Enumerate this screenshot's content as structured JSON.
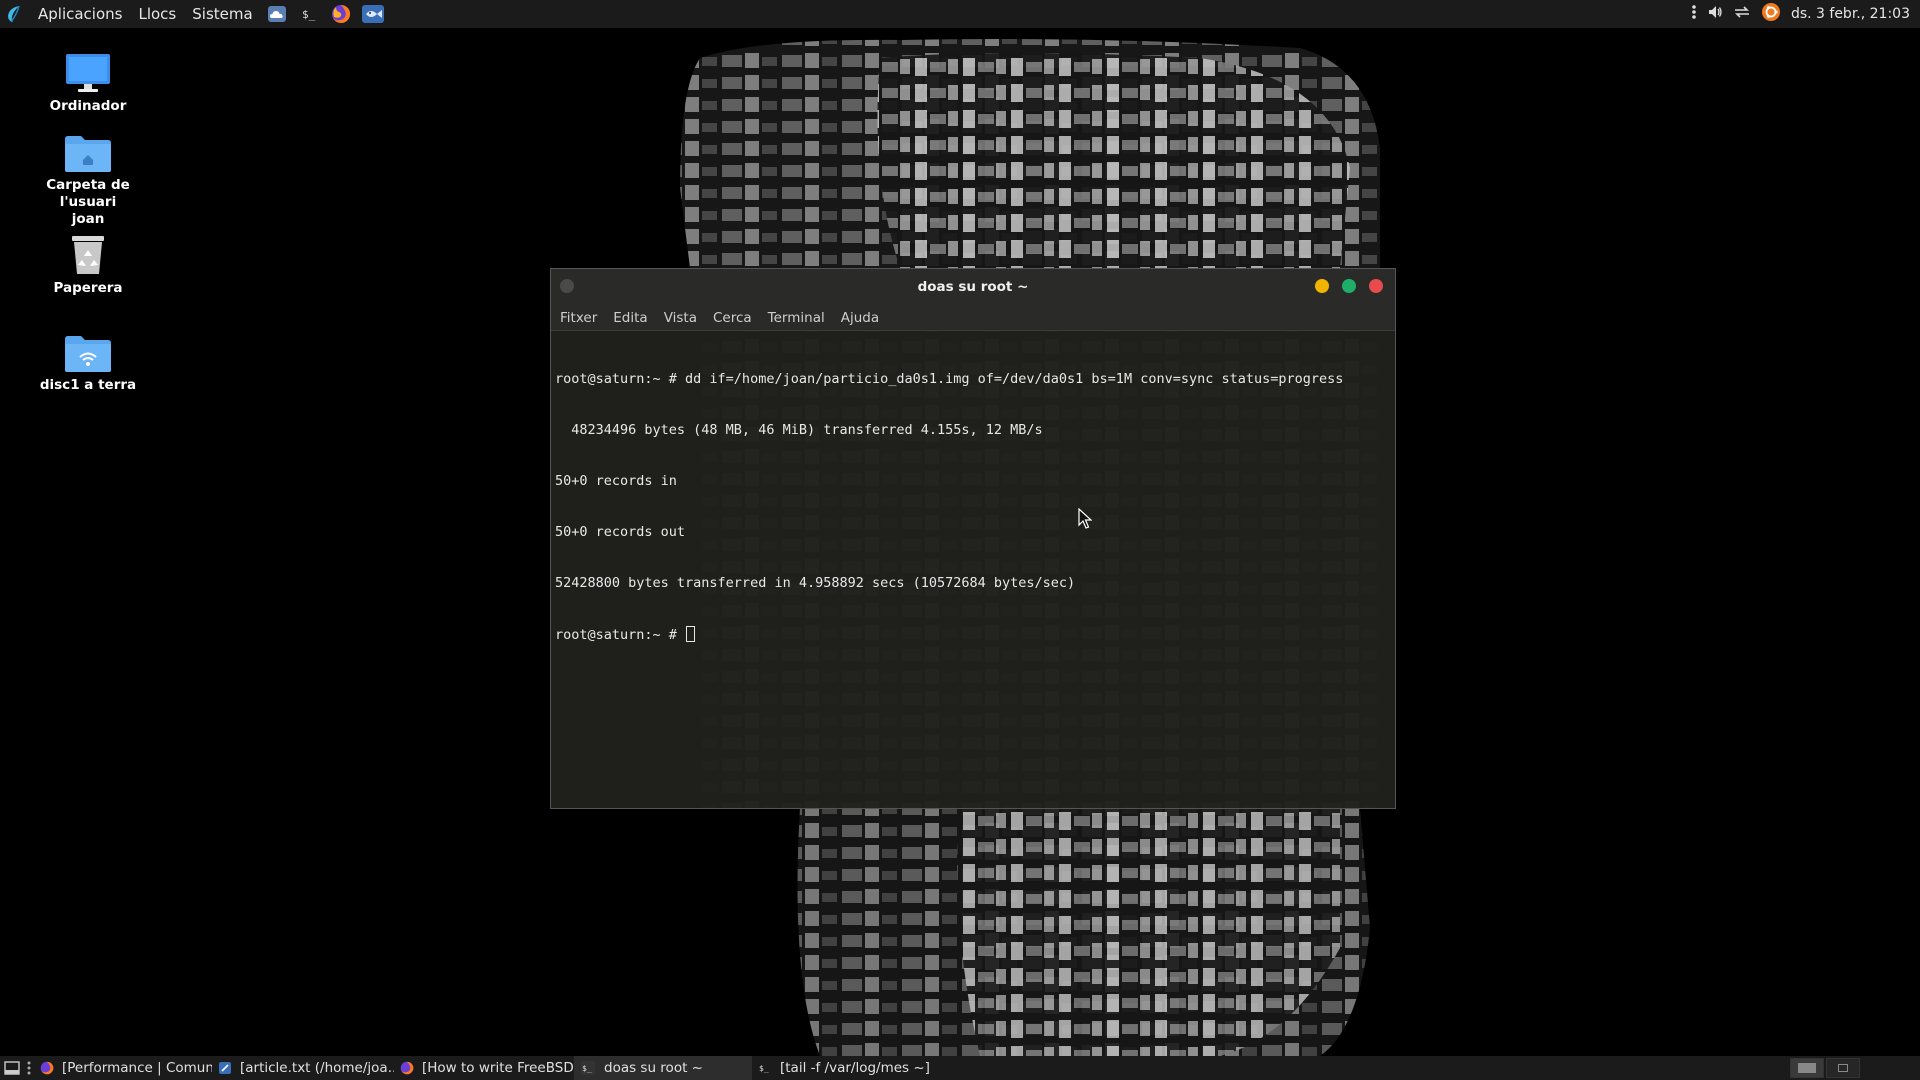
{
  "top_panel": {
    "menus": [
      "Aplicacions",
      "Llocs",
      "Sistema"
    ],
    "launchers": [
      "cloud-icon",
      "terminal-icon",
      "firefox-icon",
      "fish-icon"
    ],
    "tray_icons": [
      "menu-dots-icon",
      "volume-icon",
      "network-icon",
      "ubuntu-icon"
    ],
    "clock": "ds. 3 febr., 21:03"
  },
  "desktop_icons": [
    {
      "label": "Ordinador",
      "icon": "computer-icon"
    },
    {
      "label": "Carpeta de l'usuari\njoan",
      "icon": "home-folder-icon"
    },
    {
      "label": "Paperera",
      "icon": "trash-icon"
    },
    {
      "label": "disc1 a terra",
      "icon": "network-folder-icon"
    }
  ],
  "terminal": {
    "title": "doas su root ~",
    "menu": [
      "Fitxer",
      "Edita",
      "Vista",
      "Cerca",
      "Terminal",
      "Ajuda"
    ],
    "lines": [
      "root@saturn:~ # dd if=/home/joan/particio_da0s1.img of=/dev/da0s1 bs=1M conv=sync status=progress",
      "  48234496 bytes (48 MB, 46 MiB) transferred 4.155s, 12 MB/s",
      "50+0 records in",
      "50+0 records out",
      "52428800 bytes transferred in 4.958892 secs (10572684 bytes/sec)"
    ],
    "prompt": "root@saturn:~ # ",
    "colors": {
      "minimize": "#f0b400",
      "maximize": "#1fae6a",
      "close": "#e74c4c"
    }
  },
  "taskbar": {
    "tasks": [
      {
        "label": "[Performance | Comun...",
        "icon": "firefox-icon"
      },
      {
        "label": "[article.txt (/home/joa...",
        "icon": "editor-icon"
      },
      {
        "label": "[How to write FreeBSD ...",
        "icon": "firefox-icon"
      },
      {
        "label": "doas su root ~",
        "icon": "terminal-icon"
      },
      {
        "label": "[tail -f /var/log/mes ~]",
        "icon": "terminal-icon"
      }
    ]
  }
}
